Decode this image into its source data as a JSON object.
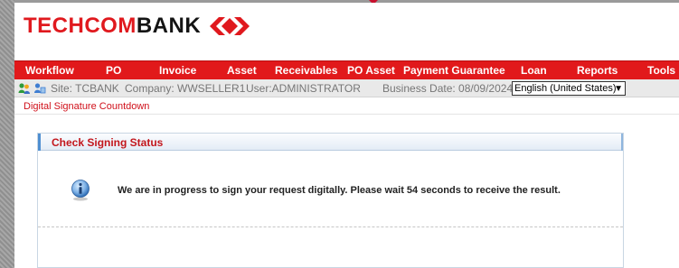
{
  "brand": {
    "logo_red": "TECHCOM",
    "logo_black": "BANK",
    "accent_color": "#e1191b"
  },
  "nav": {
    "items": [
      {
        "label": "Workflow"
      },
      {
        "label": "PO"
      },
      {
        "label": "Invoice"
      },
      {
        "label": "Asset"
      },
      {
        "label": "Receivables"
      },
      {
        "label": "PO Asset"
      },
      {
        "label": "Payment Guarantee"
      },
      {
        "label": "Loan"
      },
      {
        "label": "Reports"
      },
      {
        "label": "Tools"
      }
    ]
  },
  "infobar": {
    "icons": [
      "users-green-icon",
      "users-blue-icon"
    ],
    "site": "Site: TCBANK",
    "company": "Company: WWSELLER1",
    "user": "User:ADMINISTRATOR",
    "business_date": "Business Date: 08/09/2024",
    "language": "English (United States)"
  },
  "subnav": {
    "link": "Digital Signature Countdown"
  },
  "panel": {
    "title": "Check Signing Status",
    "icon": "info-icon",
    "message": "We are in progress to sign your request digitally. Please wait 54 seconds to receive the result."
  }
}
